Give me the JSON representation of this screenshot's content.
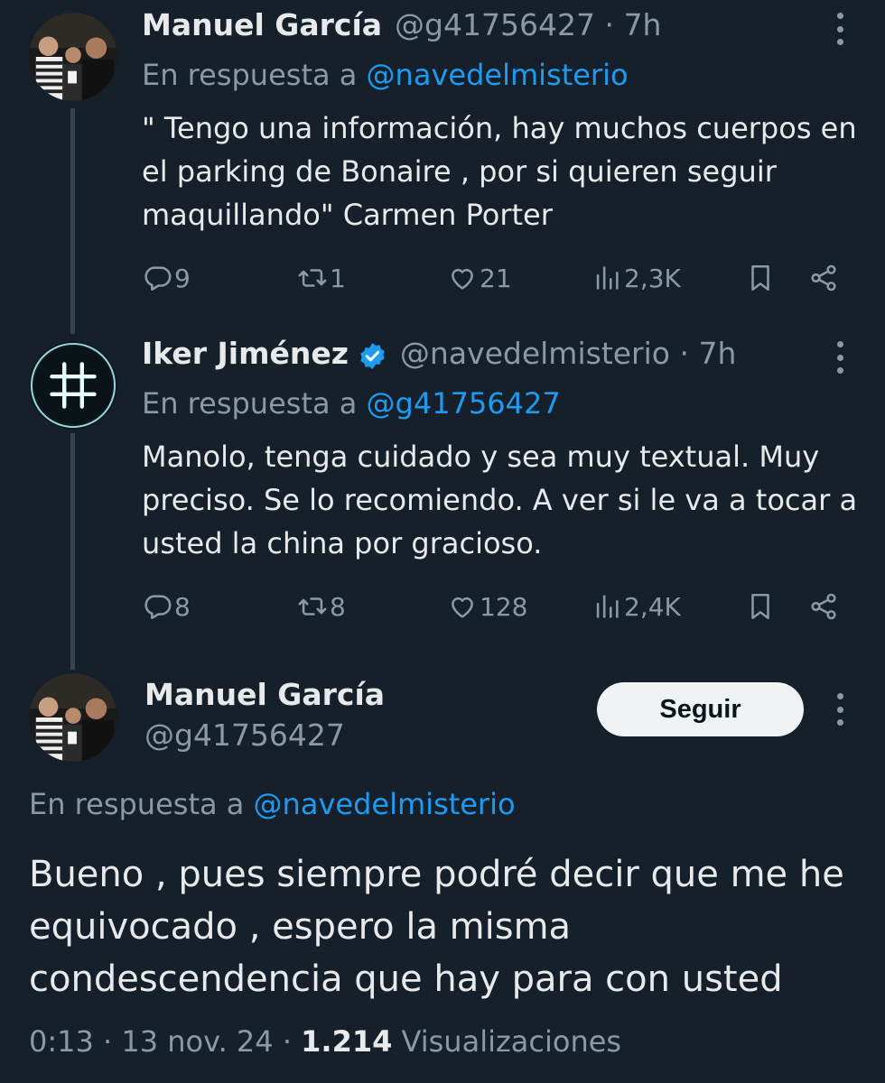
{
  "tweets": [
    {
      "name": "Manuel García",
      "handle": "@g41756427",
      "time": "· 7h",
      "reply_prefix": "En respuesta a",
      "reply_to": "@navedelmisterio",
      "text": "\" Tengo una información, hay muchos cuerpos en el parking de Bonaire , por si quieren seguir maquillando\" Carmen Porter",
      "replies": "9",
      "retweets": "1",
      "likes": "21",
      "views": "2,3K"
    },
    {
      "name": "Iker Jiménez",
      "handle": "@navedelmisterio",
      "time": "· 7h",
      "reply_prefix": "En respuesta a",
      "reply_to": "@g41756427",
      "text": "Manolo, tenga cuidado y sea muy textual. Muy preciso. Se lo recomiendo. A ver si le va a tocar a usted la china por gracioso.",
      "replies": "8",
      "retweets": "8",
      "likes": "128",
      "views": "2,4K"
    }
  ],
  "main": {
    "name": "Manuel García",
    "handle": "@g41756427",
    "follow_label": "Seguir",
    "reply_prefix": "En respuesta a",
    "reply_to": "@navedelmisterio",
    "text": "Bueno , pues siempre podré decir que me he equivocado , espero la misma condescendencia que hay para con usted",
    "time": "0:13 · 13 nov. 24 ·",
    "views_count": "1.214",
    "views_label": "Visualizaciones"
  },
  "colors": {
    "background": "#15202b",
    "accent": "#1d9bf0",
    "muted": "#8b98a5",
    "text": "#e7e9ea"
  },
  "icons": [
    "reply-icon",
    "retweet-icon",
    "like-icon",
    "views-icon",
    "bookmark-icon",
    "share-icon",
    "more-icon",
    "verified-icon",
    "hashtag-logo-icon"
  ]
}
